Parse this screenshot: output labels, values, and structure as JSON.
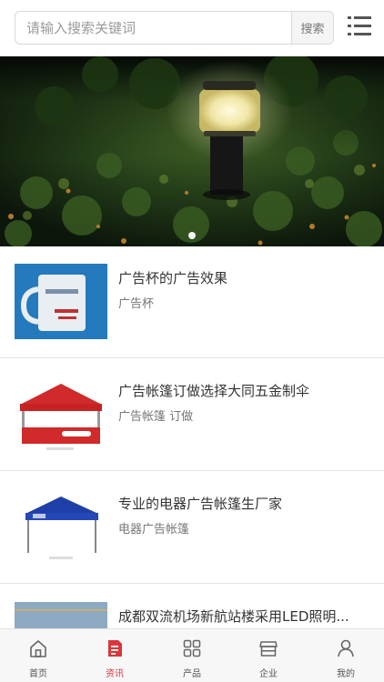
{
  "search": {
    "placeholder": "请输入搜索关键词",
    "button_label": "搜索"
  },
  "banner": {
    "slide_count": 1,
    "active_slide": 1
  },
  "news": [
    {
      "title": "广告杯的广告效果",
      "tags": "广告杯"
    },
    {
      "title": "广告帐篷订做选择大同五金制伞",
      "tags": "广告帐篷 订做"
    },
    {
      "title": "专业的电器广告帐篷生厂家",
      "tags": "电器广告帐篷"
    },
    {
      "title": "成都双流机场新航站楼采用LED照明...",
      "tags": ""
    }
  ],
  "tabbar": {
    "items": [
      {
        "label": "首页",
        "icon": "home-icon"
      },
      {
        "label": "资讯",
        "icon": "news-icon",
        "active": true
      },
      {
        "label": "产品",
        "icon": "grid-icon"
      },
      {
        "label": "企业",
        "icon": "store-icon"
      },
      {
        "label": "我的",
        "icon": "user-icon"
      }
    ]
  },
  "colors": {
    "accent": "#d9363e",
    "divider": "#e3e3e3",
    "tabbar_bg": "#f7f7f7"
  }
}
